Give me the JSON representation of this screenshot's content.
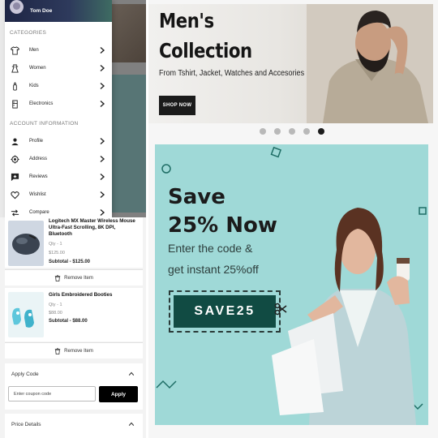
{
  "drawer": {
    "user_name": "Tom Doe",
    "categories_title": "CATEGORIES",
    "categories": [
      {
        "label": "Men",
        "icon": "tshirt-icon"
      },
      {
        "label": "Women",
        "icon": "dress-icon"
      },
      {
        "label": "Kids",
        "icon": "baby-bottle-icon"
      },
      {
        "label": "Electronics",
        "icon": "fridge-icon"
      }
    ],
    "account_title": "ACCOUNT INFORMATION",
    "account": [
      {
        "label": "Profile",
        "icon": "person-icon"
      },
      {
        "label": "Address",
        "icon": "location-icon"
      },
      {
        "label": "Reviews",
        "icon": "review-icon"
      },
      {
        "label": "Wishlist",
        "icon": "heart-icon"
      },
      {
        "label": "Compare",
        "icon": "compare-icon"
      }
    ]
  },
  "cart": {
    "items": [
      {
        "title": "Logitech MX Master Wireless Mouse Ultra-Fast Scrolling, 8K DPI, Bluetooth",
        "qty": "Qty - 1",
        "price": "$125.00",
        "subtotal": "Subtotal - $125.00"
      },
      {
        "title": "Girls Embroidered Booties",
        "qty": "Qty - 1",
        "price": "$88.00",
        "subtotal": "Subtotal - $88.00"
      }
    ],
    "remove_label": "Remove Item",
    "apply_code_title": "Apply Code",
    "coupon_placeholder": "Enter coupon code",
    "apply_label": "Apply",
    "price_details_title": "Price Details"
  },
  "banner": {
    "title_line1": "Men's",
    "title_line2": "Collection",
    "subtitle": "From Tshirt, Jacket, Watches and Accesories",
    "cta": "SHOP NOW",
    "slides": 5,
    "active_slide": 5
  },
  "promo": {
    "headline1": "Save",
    "headline2": "25% Now",
    "line1": "Enter the code &",
    "line2": "get instant 25%off",
    "code": "SAVE25"
  },
  "colors": {
    "dark_green": "#114b43",
    "teal_bg": "#9fd9d7",
    "header_navy": "#1e2545"
  }
}
